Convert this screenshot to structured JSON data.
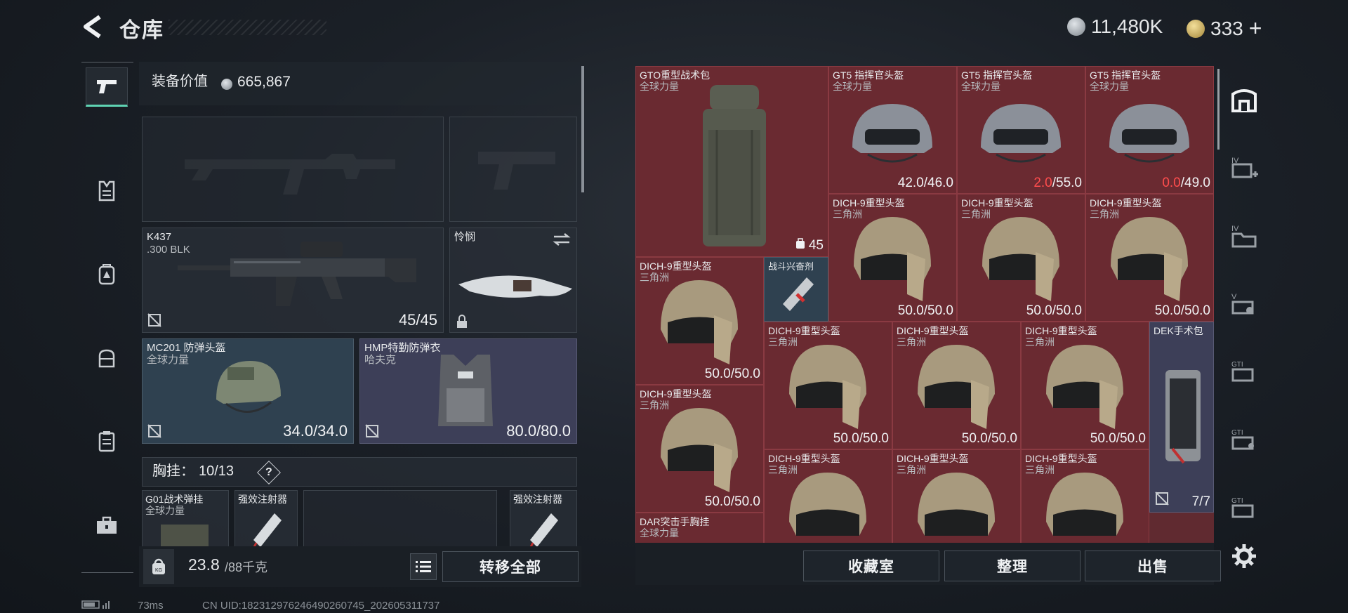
{
  "header": {
    "title": "仓库",
    "currency_1": "11,480K",
    "currency_2": "333",
    "add_symbol": "+"
  },
  "left": {
    "equip_value_label": "装备价值",
    "equip_value": "665,867",
    "primary_weapon": {
      "name": "K437",
      "ammo_type": ".300 BLK",
      "ammo": "45/45"
    },
    "melee": {
      "name": "怜悯"
    },
    "helmet": {
      "name": "MC201 防弹头盔",
      "faction": "全球力量",
      "durability": "34.0/34.0"
    },
    "armor": {
      "name": "HMP特勤防弹衣",
      "faction": "哈夫克",
      "durability": "80.0/80.0"
    },
    "chest_rig_label": "胸挂：",
    "chest_rig_count": "10/13",
    "help": "?",
    "rig_slots": [
      {
        "name": "G01战术弹挂",
        "faction": "全球力量"
      },
      {
        "name": "强效注射器"
      },
      {
        "name": "强效注射器"
      }
    ],
    "weight": "23.8",
    "weight_max": "/88千克",
    "transfer_all": "转移全部"
  },
  "grid": {
    "items": [
      {
        "name": "GTO重型战术包",
        "faction": "全球力量",
        "count": "45"
      },
      {
        "name": "GT5 指挥官头盔",
        "faction": "全球力量",
        "cur": "42.0",
        "max": "/46.0",
        "low": false
      },
      {
        "name": "GT5 指挥官头盔",
        "faction": "全球力量",
        "cur": "2.0",
        "max": "/55.0",
        "low": true
      },
      {
        "name": "GT5 指挥官头盔",
        "faction": "全球力量",
        "cur": "0.0",
        "max": "/49.0",
        "low": true
      },
      {
        "name": "DICH-9重型头盔",
        "faction": "三角洲",
        "dura": "50.0/50.0"
      },
      {
        "name": "DICH-9重型头盔",
        "faction": "三角洲",
        "dura": "50.0/50.0"
      },
      {
        "name": "DICH-9重型头盔",
        "faction": "三角洲",
        "dura": "50.0/50.0"
      },
      {
        "name": "DICH-9重型头盔",
        "faction": "三角洲",
        "dura": "50.0/50.0"
      },
      {
        "name": "战斗兴奋剂"
      },
      {
        "name": "DICH-9重型头盔",
        "faction": "三角洲",
        "dura": "50.0/50.0"
      },
      {
        "name": "DICH-9重型头盔",
        "faction": "三角洲",
        "dura": "50.0/50.0"
      },
      {
        "name": "DICH-9重型头盔",
        "faction": "三角洲",
        "dura": "50.0/50.0"
      },
      {
        "name": "DEK手术包",
        "uses": "7/7"
      },
      {
        "name": "DICH-9重型头盔",
        "faction": "三角洲",
        "dura": "50.0/50.0"
      },
      {
        "name": "DICH-9重型头盔",
        "faction": "三角洲"
      },
      {
        "name": "DICH-9重型头盔",
        "faction": "三角洲"
      },
      {
        "name": "DICH-9重型头盔",
        "faction": "三角洲"
      },
      {
        "name": "DAR突击手胸挂",
        "faction": "全球力量"
      }
    ],
    "btn_collection": "收藏室",
    "btn_sort": "整理",
    "btn_sell": "出售"
  },
  "footer": {
    "ping": "73ms",
    "uid": "CN UID:18231297624649026074​5_202605311737"
  }
}
